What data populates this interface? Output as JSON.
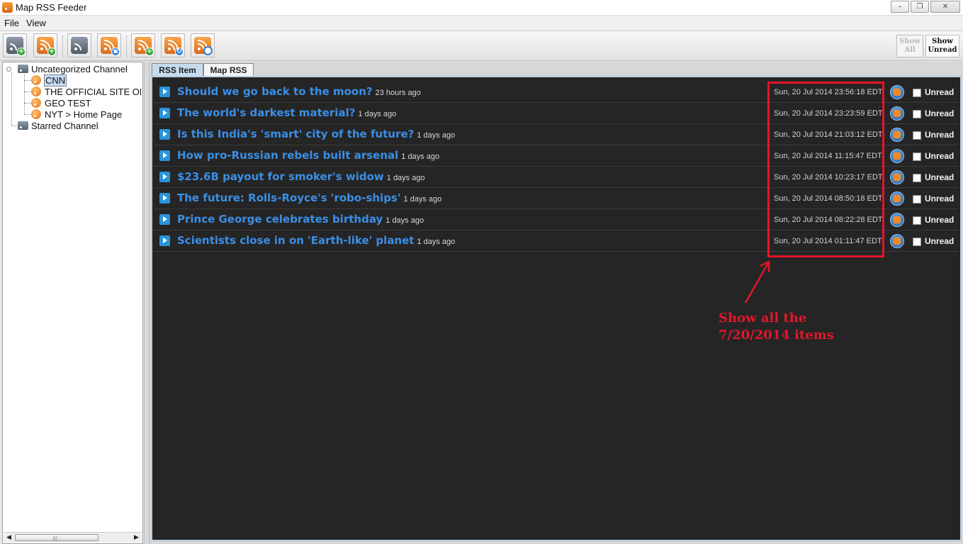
{
  "window": {
    "title": "Map RSS Feeder",
    "controls": [
      "minimize",
      "restore",
      "close"
    ]
  },
  "menu": [
    "File",
    "View"
  ],
  "toolbar": {
    "buttons": [
      {
        "icon": "add-folder-icon"
      },
      {
        "icon": "add-feed-icon"
      },
      {
        "icon": "open-folder-icon"
      },
      {
        "icon": "save-feed-icon"
      },
      {
        "icon": "add-feed-green-icon"
      },
      {
        "icon": "refresh-feed-icon"
      },
      {
        "icon": "search-feed-icon"
      }
    ],
    "show_all": "Show All",
    "show_unread": "Show Unread"
  },
  "tree": {
    "root": "Uncategorized Channel",
    "children": [
      "CNN",
      "THE OFFICIAL SITE OF T",
      "GEO TEST",
      "NYT > Home Page"
    ],
    "selected": "CNN",
    "starred": "Starred Channel"
  },
  "tabs": [
    {
      "label": "RSS Item",
      "active": true
    },
    {
      "label": "Map RSS",
      "active": false
    }
  ],
  "items": [
    {
      "title": "Should we go back to the moon?",
      "ago": "23 hours ago",
      "date": "Sun, 20 Jul 2014 23:56:18 EDT",
      "unread_label": "Unread"
    },
    {
      "title": "The world's darkest material?",
      "ago": "1 days ago",
      "date": "Sun, 20 Jul 2014 23:23:59 EDT",
      "unread_label": "Unread"
    },
    {
      "title": "Is this India's 'smart' city of the future?",
      "ago": "1 days ago",
      "date": "Sun, 20 Jul 2014 21:03:12 EDT",
      "unread_label": "Unread"
    },
    {
      "title": "How pro-Russian rebels built arsenal",
      "ago": "1 days ago",
      "date": "Sun, 20 Jul 2014 11:15:47 EDT",
      "unread_label": "Unread"
    },
    {
      "title": "$23.6B payout for smoker's widow",
      "ago": "1 days ago",
      "date": "Sun, 20 Jul 2014 10:23:17 EDT",
      "unread_label": "Unread"
    },
    {
      "title": "The future: Rolls-Royce's 'robo-ships'",
      "ago": "1 days ago",
      "date": "Sun, 20 Jul 2014 08:50:18 EDT",
      "unread_label": "Unread"
    },
    {
      "title": "Prince George celebrates birthday",
      "ago": "1 days ago",
      "date": "Sun, 20 Jul 2014 08:22:28 EDT",
      "unread_label": "Unread"
    },
    {
      "title": "Scientists close in on 'Earth-like' planet",
      "ago": "1 days ago",
      "date": "Sun, 20 Jul 2014 01:11:47 EDT",
      "unread_label": "Unread"
    }
  ],
  "annotation": {
    "line1": "Show all the",
    "line2": "7/20/2014 items",
    "color": "#e3162a"
  },
  "colors": {
    "title_link": "#3a8fe6",
    "content_bg": "#252525",
    "tab_active": "#c5dcef"
  }
}
